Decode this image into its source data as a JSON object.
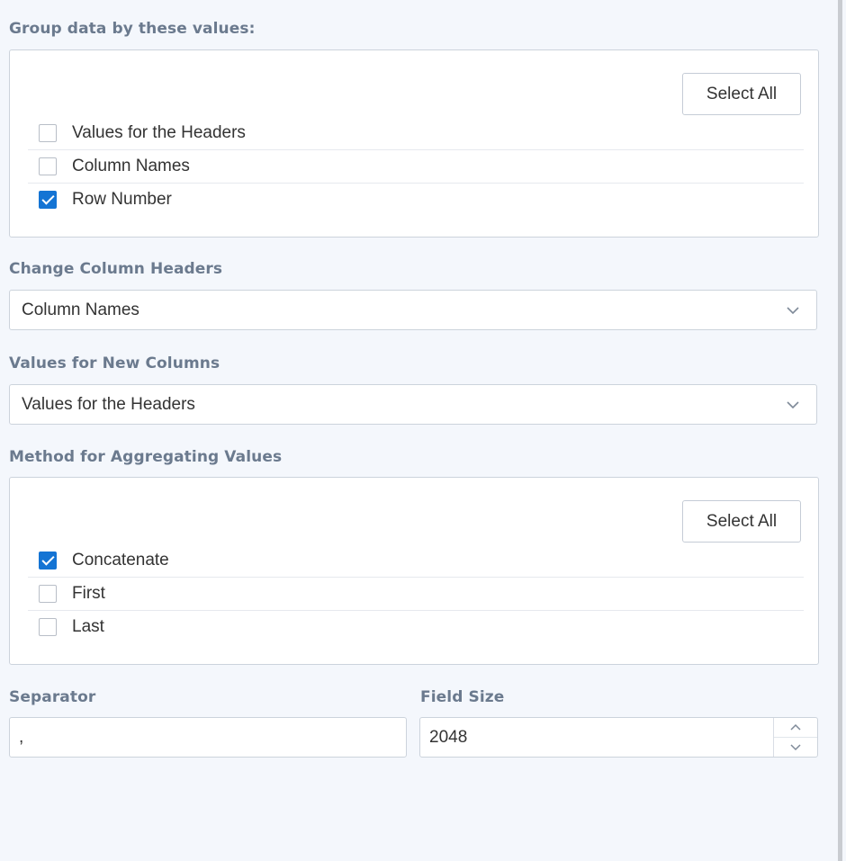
{
  "group_section": {
    "label": "Group data by these values:",
    "select_all_label": "Select All",
    "items": [
      {
        "label": "Values for the Headers",
        "checked": false
      },
      {
        "label": "Column Names",
        "checked": false
      },
      {
        "label": "Row Number",
        "checked": true
      }
    ]
  },
  "column_headers": {
    "label": "Change Column Headers",
    "value": "Column Names",
    "icon": "chevron-down-icon"
  },
  "new_columns": {
    "label": "Values for New Columns",
    "value": "Values for the Headers",
    "icon": "chevron-down-icon"
  },
  "aggregate_section": {
    "label": "Method for Aggregating Values",
    "select_all_label": "Select All",
    "items": [
      {
        "label": "Concatenate",
        "checked": true
      },
      {
        "label": "First",
        "checked": false
      },
      {
        "label": "Last",
        "checked": false
      }
    ]
  },
  "separator": {
    "label": "Separator",
    "value": ","
  },
  "field_size": {
    "label": "Field Size",
    "value": "2048"
  },
  "colors": {
    "accent": "#1474d4",
    "label_text": "#6b7a8e",
    "background": "#f4f7fc"
  }
}
